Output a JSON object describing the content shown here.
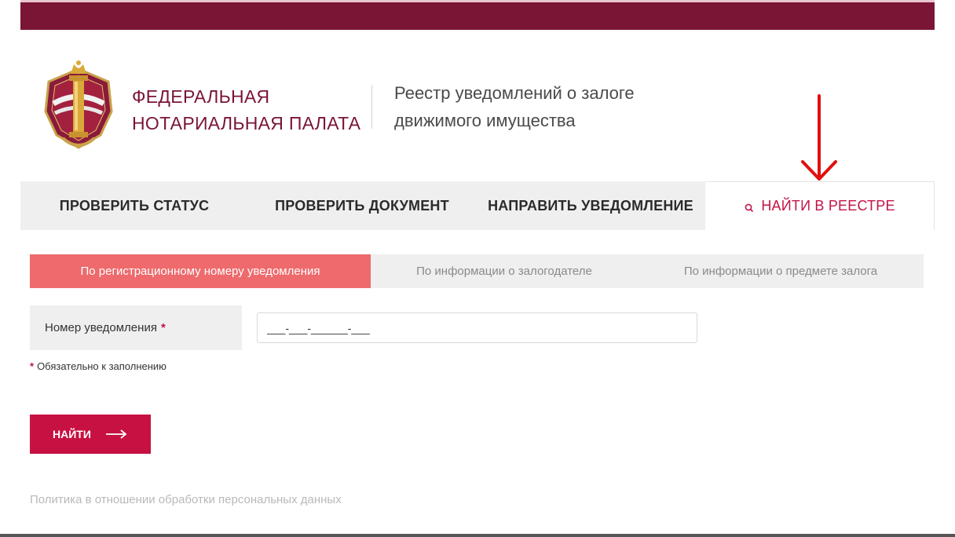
{
  "header": {
    "brand_line1": "ФЕДЕРАЛЬНАЯ",
    "brand_line2": "НОТАРИАЛЬНАЯ ПАЛАТА",
    "registry_line1": "Реестр уведомлений о залоге",
    "registry_line2": "движимого имущества"
  },
  "nav": {
    "tabs": [
      {
        "label": "ПРОВЕРИТЬ СТАТУС"
      },
      {
        "label": "ПРОВЕРИТЬ ДОКУМЕНТ"
      },
      {
        "label": "НАПРАВИТЬ УВЕДОМЛЕНИЕ"
      },
      {
        "label": "НАЙТИ В РЕЕСТРЕ",
        "active": true,
        "icon": "search-icon"
      }
    ]
  },
  "search": {
    "subtabs": [
      {
        "label": "По регистрационному номеру уведомления",
        "active": true
      },
      {
        "label": "По информации о залогодателе"
      },
      {
        "label": "По информации о предмете залога"
      }
    ],
    "field_label": "Номер уведомления",
    "required_mark": "*",
    "input_mask": "___-___-______-___",
    "required_note": "Обязательно к заполнению",
    "submit_label": "НАЙТИ"
  },
  "footer": {
    "policy_link": "Политика в отношении обработки персональных данных"
  },
  "colors": {
    "brand": "#7a1535",
    "accent": "#c71142",
    "active_subtab": "#ee6a6c",
    "annotation": "#e01010"
  }
}
